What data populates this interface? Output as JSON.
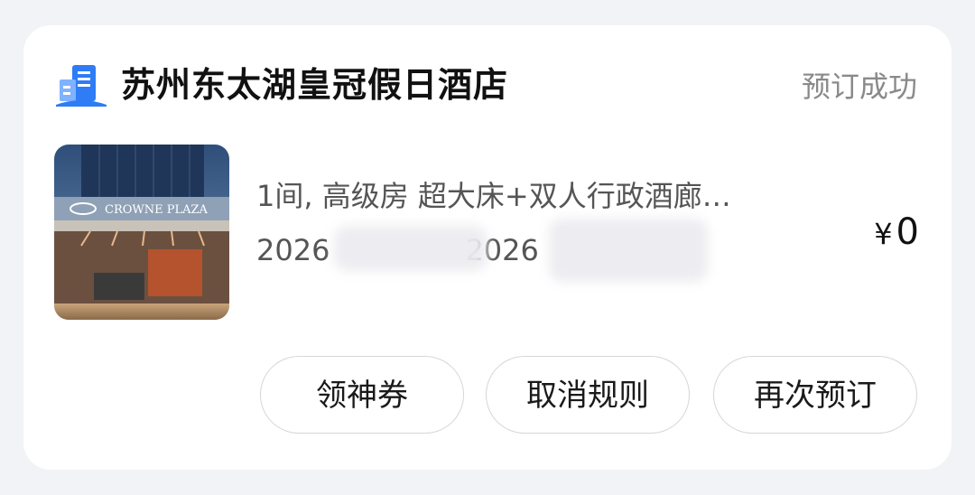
{
  "order": {
    "hotel_name": "苏州东太湖皇冠假日酒店",
    "status": "预订成功",
    "room_description": "1间, 高级房 超大床+双人行政酒廊…",
    "check_in": "2026",
    "check_out": "2026",
    "currency": "¥",
    "price": "0",
    "image_brand_text": "CROWNE PLAZA"
  },
  "actions": {
    "coupon_label": "领神券",
    "cancel_rules_label": "取消规则",
    "rebook_label": "再次预订"
  },
  "icons": {
    "hotel": "hotel-building-icon"
  },
  "colors": {
    "status_text": "#8a8a8a",
    "icon_blue": "#2e7cf6"
  }
}
